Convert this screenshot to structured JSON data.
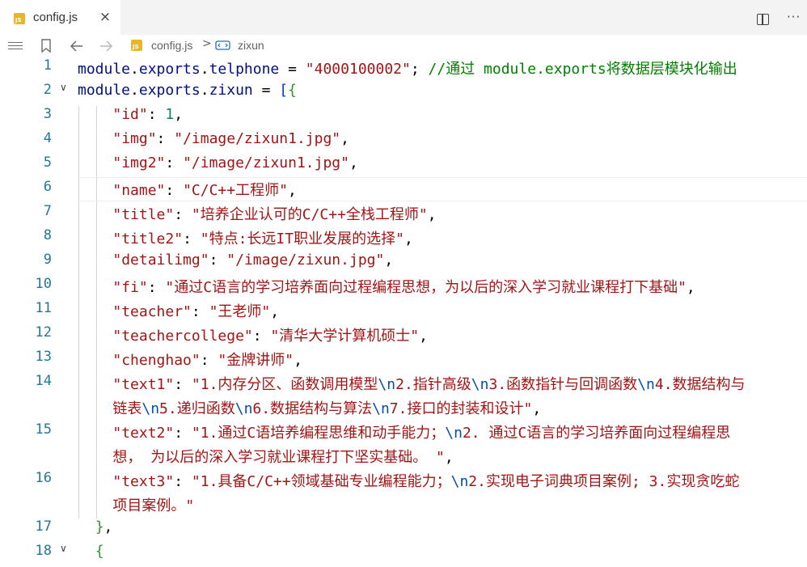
{
  "tab": {
    "icon": "js-file-icon",
    "icon_text": "JS",
    "title": "config.js",
    "close": "×"
  },
  "toolbar": {
    "more": "···"
  },
  "breadcrumb": {
    "file": "config.js",
    "separator": ">",
    "symbol": "zixun"
  },
  "colors": {
    "keyword": "#001080",
    "string": "#a31515",
    "number": "#098658",
    "comment": "#008000",
    "line_number": "#237893"
  },
  "lines": [
    {
      "num": "1",
      "segments": [
        [
          "kw",
          "module"
        ],
        [
          "",
          "."
        ],
        [
          "kw",
          "exports"
        ],
        [
          "",
          "."
        ],
        [
          "kw",
          "telphone"
        ],
        [
          "",
          " = "
        ],
        [
          "str",
          "\"4000100002\""
        ],
        [
          "",
          "; "
        ],
        [
          "cm",
          "//通过 module.exports将数据层模块化输出"
        ]
      ]
    },
    {
      "num": "2",
      "segments": [
        [
          "kw",
          "module"
        ],
        [
          "",
          "."
        ],
        [
          "kw",
          "exports"
        ],
        [
          "",
          "."
        ],
        [
          "kw",
          "zixun"
        ],
        [
          "",
          " = "
        ],
        [
          "br1",
          "["
        ],
        [
          "br2",
          "{"
        ]
      ]
    },
    {
      "num": "3",
      "segments": [
        [
          "",
          "    "
        ],
        [
          "str",
          "\"id\""
        ],
        [
          "",
          ": "
        ],
        [
          "num",
          "1"
        ],
        [
          "",
          ","
        ]
      ]
    },
    {
      "num": "4",
      "segments": [
        [
          "",
          "    "
        ],
        [
          "str",
          "\"img\""
        ],
        [
          "",
          ": "
        ],
        [
          "str",
          "\"/image/zixun1.jpg\""
        ],
        [
          "",
          ","
        ]
      ]
    },
    {
      "num": "5",
      "segments": [
        [
          "",
          "    "
        ],
        [
          "str",
          "\"img2\""
        ],
        [
          "",
          ": "
        ],
        [
          "str",
          "\"/image/zixun1.jpg\""
        ],
        [
          "",
          ","
        ]
      ]
    },
    {
      "num": "6",
      "segments": [
        [
          "",
          "    "
        ],
        [
          "str",
          "\"name\""
        ],
        [
          "",
          ": "
        ],
        [
          "str",
          "\"C/C++工程师\""
        ],
        [
          "",
          ","
        ]
      ]
    },
    {
      "num": "7",
      "segments": [
        [
          "",
          "    "
        ],
        [
          "str",
          "\"title\""
        ],
        [
          "",
          ": "
        ],
        [
          "str",
          "\"培养企业认可的C/C++全栈工程师\""
        ],
        [
          "",
          ","
        ]
      ]
    },
    {
      "num": "8",
      "segments": [
        [
          "",
          "    "
        ],
        [
          "str",
          "\"title2\""
        ],
        [
          "",
          ": "
        ],
        [
          "str",
          "\"特点:长远IT职业发展的选择\""
        ],
        [
          "",
          ","
        ]
      ]
    },
    {
      "num": "9",
      "segments": [
        [
          "",
          "    "
        ],
        [
          "str",
          "\"detailimg\""
        ],
        [
          "",
          ": "
        ],
        [
          "str",
          "\"/image/zixun.jpg\""
        ],
        [
          "",
          ","
        ]
      ]
    },
    {
      "num": "10",
      "segments": [
        [
          "",
          "    "
        ],
        [
          "str",
          "\"fi\""
        ],
        [
          "",
          ": "
        ],
        [
          "str",
          "\"通过C语言的学习培养面向过程编程思想，为以后的深入学习就业课程打下基础\""
        ],
        [
          "",
          ","
        ]
      ]
    },
    {
      "num": "11",
      "segments": [
        [
          "",
          "    "
        ],
        [
          "str",
          "\"teacher\""
        ],
        [
          "",
          ": "
        ],
        [
          "str",
          "\"王老师\""
        ],
        [
          "",
          ","
        ]
      ]
    },
    {
      "num": "12",
      "segments": [
        [
          "",
          "    "
        ],
        [
          "str",
          "\"teachercollege\""
        ],
        [
          "",
          ": "
        ],
        [
          "str",
          "\"清华大学计算机硕士\""
        ],
        [
          "",
          ","
        ]
      ]
    },
    {
      "num": "13",
      "segments": [
        [
          "",
          "    "
        ],
        [
          "str",
          "\"chenghao\""
        ],
        [
          "",
          ": "
        ],
        [
          "str",
          "\"金牌讲师\""
        ],
        [
          "",
          ","
        ]
      ]
    }
  ],
  "wrapped": [
    {
      "num": "14",
      "row1": [
        [
          "",
          "    "
        ],
        [
          "str",
          "\"text1\""
        ],
        [
          "",
          ": "
        ],
        [
          "str",
          "\"1.内存分区、函数调用模型"
        ],
        [
          "esc2",
          "\\n"
        ],
        [
          "str",
          "2.指针高级"
        ],
        [
          "esc2",
          "\\n"
        ],
        [
          "str",
          "3.函数指针与回调函数"
        ],
        [
          "esc2",
          "\\n"
        ],
        [
          "str",
          "4.数据结构与"
        ]
      ],
      "row2": [
        [
          "",
          "    "
        ],
        [
          "str",
          "链表"
        ],
        [
          "esc2",
          "\\n"
        ],
        [
          "str",
          "5.递归函数"
        ],
        [
          "esc2",
          "\\n"
        ],
        [
          "str",
          "6.数据结构与算法"
        ],
        [
          "esc2",
          "\\n"
        ],
        [
          "str",
          "7.接口的封装和设计\""
        ],
        [
          "",
          ","
        ]
      ]
    },
    {
      "num": "15",
      "row1": [
        [
          "",
          "    "
        ],
        [
          "str",
          "\"text2\""
        ],
        [
          "",
          ": "
        ],
        [
          "str",
          "\"1.通过C语培养编程思维和动手能力；"
        ],
        [
          "esc2",
          "\\n"
        ],
        [
          "str",
          "2. 通过C语言的学习培养面向过程编程思"
        ]
      ],
      "row2": [
        [
          "",
          "    "
        ],
        [
          "str",
          "想， 为以后的深入学习就业课程打下坚实基础。 \""
        ],
        [
          "",
          ","
        ]
      ]
    },
    {
      "num": "16",
      "row1": [
        [
          "",
          "    "
        ],
        [
          "str",
          "\"text3\""
        ],
        [
          "",
          ": "
        ],
        [
          "str",
          "\"1.具备C/C++领域基础专业编程能力；"
        ],
        [
          "esc2",
          "\\n"
        ],
        [
          "str",
          "2.实现电子词典项目案例; 3.实现贪吃蛇"
        ]
      ],
      "row2": [
        [
          "",
          "    "
        ],
        [
          "str",
          "项目案例。\""
        ]
      ]
    }
  ],
  "tail": [
    {
      "num": "17",
      "segments": [
        [
          "",
          "  "
        ],
        [
          "br2",
          "}"
        ],
        [
          "",
          ","
        ]
      ]
    },
    {
      "num": "18",
      "segments": [
        [
          "",
          "  "
        ],
        [
          "br2",
          "{"
        ]
      ]
    }
  ]
}
